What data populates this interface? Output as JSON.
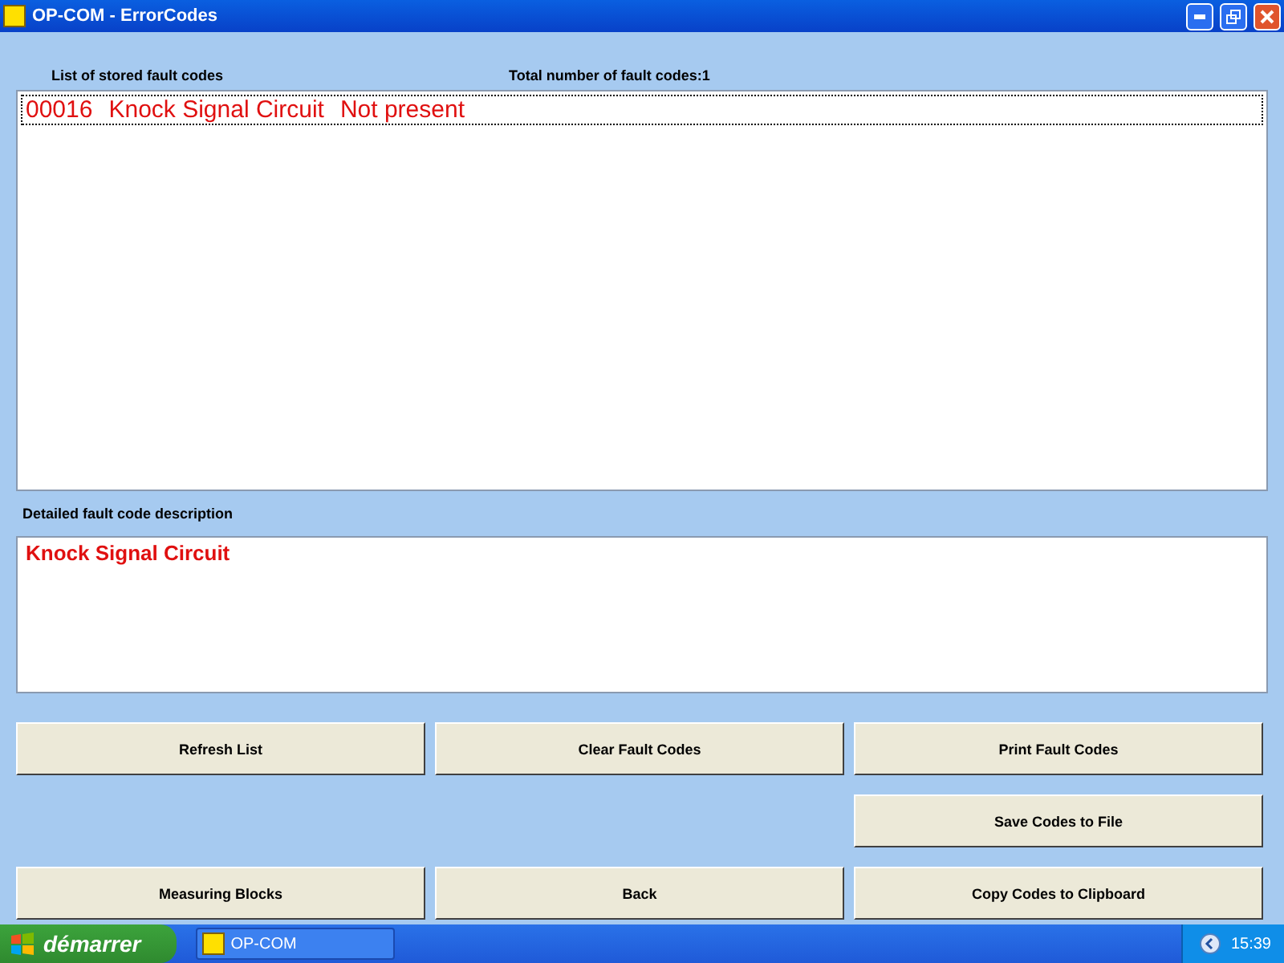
{
  "window": {
    "title": "OP-COM - ErrorCodes"
  },
  "list_label": "List of stored fault codes",
  "total_label": "Total number of fault codes:1",
  "fault_codes": [
    {
      "code": "00016",
      "name": "Knock Signal Circuit",
      "status": "Not present",
      "selected": true
    }
  ],
  "description_label": "Detailed fault code description",
  "description": "Knock Signal Circuit",
  "buttons": [
    {
      "label": "Refresh List",
      "disabled": false
    },
    {
      "label": "Clear Fault Codes",
      "disabled": false
    },
    {
      "label": "Print Fault Codes",
      "disabled": false
    },
    {
      "label": "Save Codes to File",
      "disabled": false
    },
    {
      "label": "Measuring Blocks",
      "disabled": false
    },
    {
      "label": "Back",
      "disabled": false
    },
    {
      "label": "Copy Codes to Clipboard",
      "disabled": false
    }
  ],
  "taskbar": {
    "start": "démarrer",
    "tasks": [
      {
        "label": "OP-COM",
        "selected": false
      }
    ],
    "clock": "15:39"
  }
}
